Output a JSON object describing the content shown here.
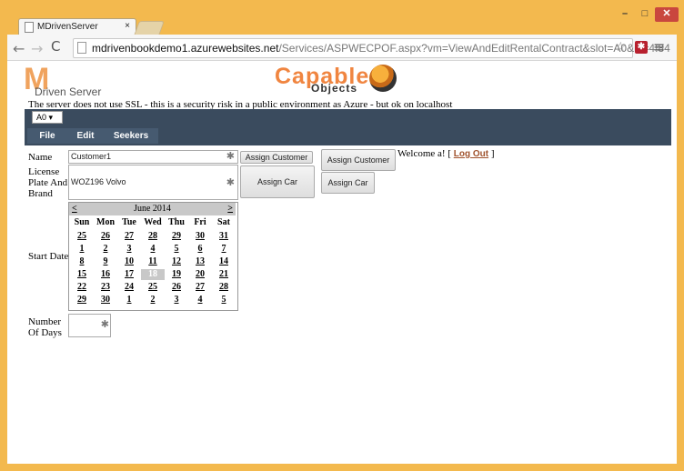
{
  "browser": {
    "tab_title": "MDrivenServer",
    "tab_close": "×",
    "url_prefix": "mdrivenbookdemo1.azurewebsites.net",
    "url_rest": "/Services/ASPWECPOF.aspx?vm=ViewAndEditRentalContract&slot=A0&id=4!84",
    "back": "←",
    "forward": "→",
    "reload": "C",
    "star": "☆",
    "extension": "✱",
    "menu": "≡",
    "win_min": "–",
    "win_max": "□",
    "win_close": "✕"
  },
  "header": {
    "logo_letter": "M",
    "logo_sub": "Driven Server",
    "brand_capable": "Capable",
    "brand_objects": "Objects",
    "ssl_warning": "The server does not use SSL - this is a security risk in a public environment as Azure - but ok on localhost"
  },
  "toolbar": {
    "slot_value": "A0 ▾",
    "menu": [
      "File",
      "Edit",
      "Seekers"
    ]
  },
  "form": {
    "name_label": "Name",
    "name_value": "Customer1",
    "assign_customer_small": "Assign Customer",
    "license_label": "License Plate And Brand",
    "license_value": "WOZ196 Volvo",
    "assign_car_mid": "Assign Car",
    "assign_customer_right": "Assign Customer",
    "assign_car_right": "Assign Car",
    "start_date_label": "Start Date",
    "days_label": "Number Of Days",
    "required_mark": "✱"
  },
  "welcome": {
    "prefix": "Welcome  a! [",
    "logout": "Log Out",
    "suffix": "]"
  },
  "calendar": {
    "month": "June 2014",
    "prev": "<",
    "next": ">",
    "weekdays": [
      "Sun",
      "Mon",
      "Tue",
      "Wed",
      "Thu",
      "Fri",
      "Sat"
    ],
    "weeks": [
      [
        "25",
        "26",
        "27",
        "28",
        "29",
        "30",
        "31"
      ],
      [
        "1",
        "2",
        "3",
        "4",
        "5",
        "6",
        "7"
      ],
      [
        "8",
        "9",
        "10",
        "11",
        "12",
        "13",
        "14"
      ],
      [
        "15",
        "16",
        "17",
        "18",
        "19",
        "20",
        "21"
      ],
      [
        "22",
        "23",
        "24",
        "25",
        "26",
        "27",
        "28"
      ],
      [
        "29",
        "30",
        "1",
        "2",
        "3",
        "4",
        "5"
      ]
    ],
    "selected": "18"
  }
}
